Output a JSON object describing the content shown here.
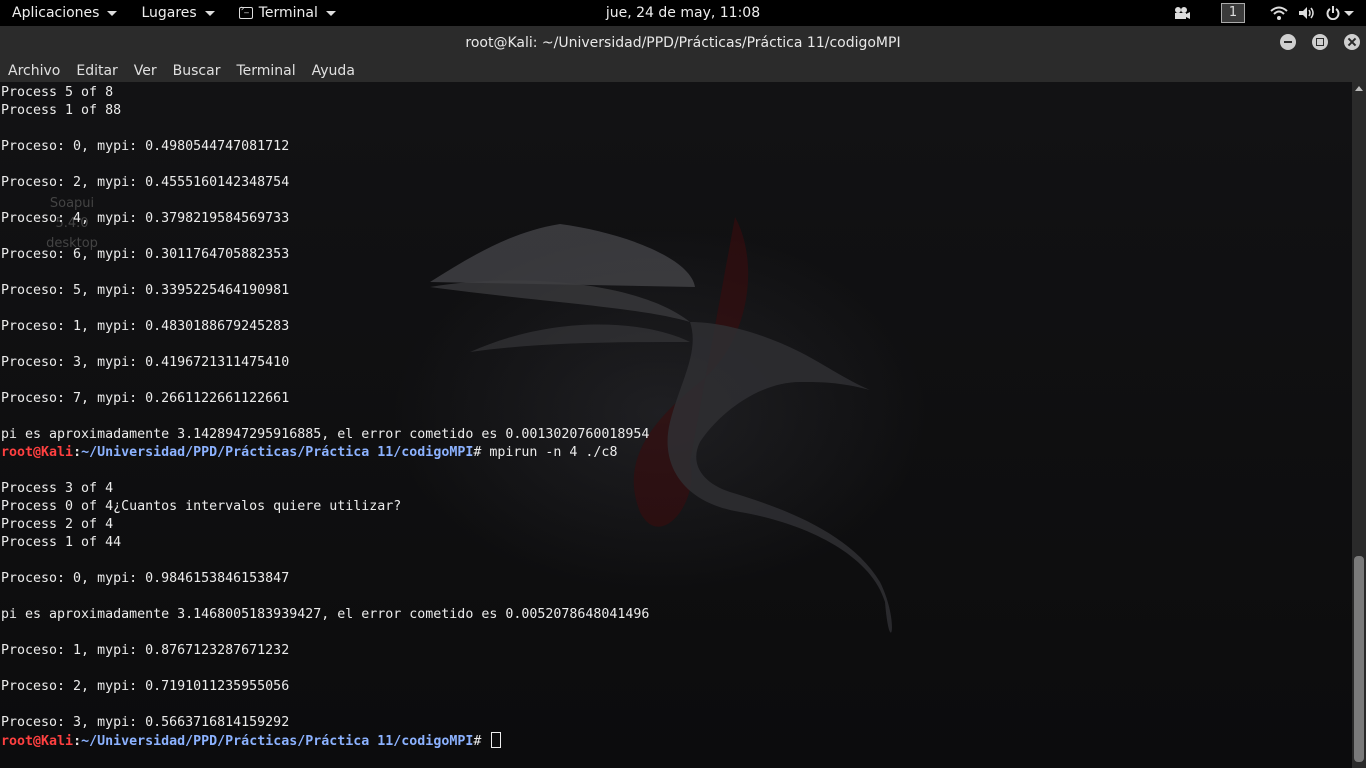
{
  "topbar": {
    "apps_label": "Aplicaciones",
    "places_label": "Lugares",
    "terminal_label": "Terminal",
    "clock": "jue, 24 de may, 11:08",
    "workspace": "1"
  },
  "window": {
    "title": "root@Kali: ~/Universidad/PPD/Prácticas/Práctica 11/codigoMPI"
  },
  "menubar": {
    "items": [
      "Archivo",
      "Editar",
      "Ver",
      "Buscar",
      "Terminal",
      "Ayuda"
    ]
  },
  "desktop_ghost": [
    "Soapui",
    "5.4.0",
    "desktop"
  ],
  "prompt": {
    "user_host": "root@Kali",
    "sep": ":",
    "path": "~/Universidad/PPD/Prácticas/Práctica 11/codigoMPI",
    "symbol": "# "
  },
  "terminal": {
    "lines": [
      {
        "type": "text",
        "text": "Process 5 of 8"
      },
      {
        "type": "text",
        "text": "Process 1 of 88"
      },
      {
        "type": "text",
        "text": ""
      },
      {
        "type": "text",
        "text": "Proceso: 0, mypi: 0.4980544747081712"
      },
      {
        "type": "text",
        "text": ""
      },
      {
        "type": "text",
        "text": "Proceso: 2, mypi: 0.4555160142348754"
      },
      {
        "type": "text",
        "text": ""
      },
      {
        "type": "text",
        "text": "Proceso: 4, mypi: 0.3798219584569733"
      },
      {
        "type": "text",
        "text": ""
      },
      {
        "type": "text",
        "text": "Proceso: 6, mypi: 0.3011764705882353"
      },
      {
        "type": "text",
        "text": ""
      },
      {
        "type": "text",
        "text": "Proceso: 5, mypi: 0.3395225464190981"
      },
      {
        "type": "text",
        "text": ""
      },
      {
        "type": "text",
        "text": "Proceso: 1, mypi: 0.4830188679245283"
      },
      {
        "type": "text",
        "text": ""
      },
      {
        "type": "text",
        "text": "Proceso: 3, mypi: 0.4196721311475410"
      },
      {
        "type": "text",
        "text": ""
      },
      {
        "type": "text",
        "text": "Proceso: 7, mypi: 0.2661122661122661"
      },
      {
        "type": "text",
        "text": ""
      },
      {
        "type": "text",
        "text": "pi es aproximadamente 3.1428947295916885, el error cometido es 0.0013020760018954"
      },
      {
        "type": "prompt",
        "cmd": "mpirun -n 4 ./c8"
      },
      {
        "type": "text",
        "text": ""
      },
      {
        "type": "text",
        "text": "Process 3 of 4"
      },
      {
        "type": "text",
        "text": "Process 0 of 4¿Cuantos intervalos quiere utilizar?"
      },
      {
        "type": "text",
        "text": "Process 2 of 4"
      },
      {
        "type": "text",
        "text": "Process 1 of 44"
      },
      {
        "type": "text",
        "text": ""
      },
      {
        "type": "text",
        "text": "Proceso: 0, mypi: 0.9846153846153847"
      },
      {
        "type": "text",
        "text": ""
      },
      {
        "type": "text",
        "text": "pi es aproximadamente 3.1468005183939427, el error cometido es 0.0052078648041496"
      },
      {
        "type": "text",
        "text": ""
      },
      {
        "type": "text",
        "text": "Proceso: 1, mypi: 0.8767123287671232"
      },
      {
        "type": "text",
        "text": ""
      },
      {
        "type": "text",
        "text": "Proceso: 2, mypi: 0.7191011235955056"
      },
      {
        "type": "text",
        "text": ""
      },
      {
        "type": "text",
        "text": "Proceso: 3, mypi: 0.5663716814159292"
      },
      {
        "type": "prompt",
        "cmd": "",
        "cursor": true
      }
    ]
  },
  "scrollbar": {
    "thumb_start_fraction": 0.69,
    "thumb_end_fraction": 1.0
  }
}
